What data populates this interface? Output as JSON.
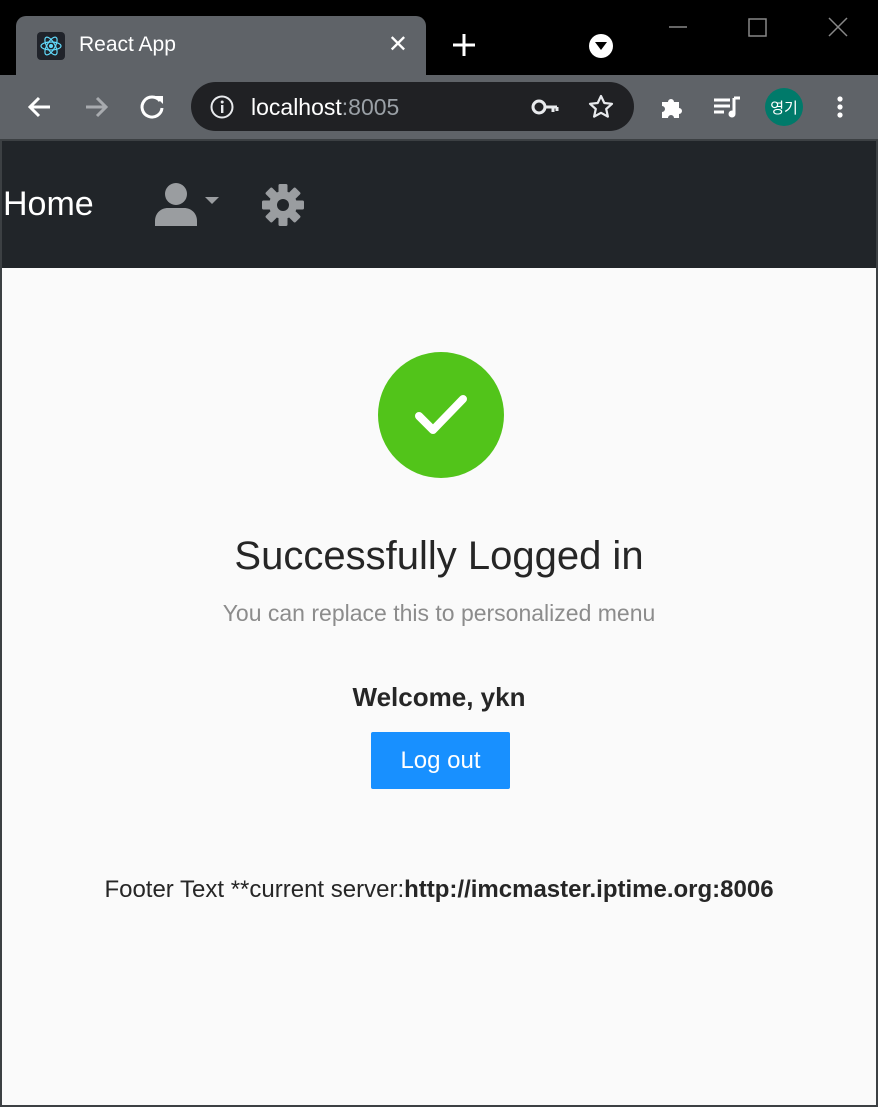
{
  "browser": {
    "tab": {
      "title": "React App",
      "close_glyph": "✕",
      "favicon": "react-logo-icon"
    },
    "address": {
      "host": "localhost",
      "port": ":8005"
    },
    "profile_initials": "영기",
    "accent_profile": "#007a6a"
  },
  "navbar": {
    "home_label": "Home",
    "user_icon": "user-icon",
    "settings_icon": "gear-icon"
  },
  "result": {
    "status": "success",
    "status_color": "#52c41a",
    "title": "Successfully Logged in",
    "subtitle": "You can replace this to personalized menu"
  },
  "user": {
    "welcome": "Welcome, ykn"
  },
  "actions": {
    "logout_label": "Log out",
    "button_color": "#1890ff"
  },
  "footer": {
    "text": "Footer Text **current server:",
    "server": "http://imcmaster.iptime.org:8006"
  }
}
